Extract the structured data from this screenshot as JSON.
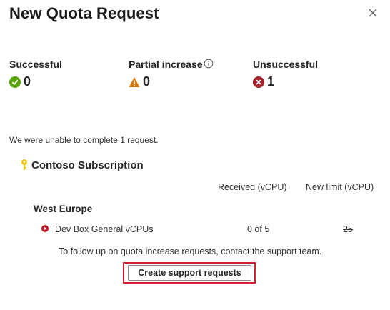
{
  "dialog": {
    "title": "New Quota Request"
  },
  "stats": {
    "successful": {
      "label": "Successful",
      "value": "0",
      "icon": "success-check-icon",
      "color": "#57a300"
    },
    "partial": {
      "label": "Partial increase",
      "value": "0",
      "icon": "warning-triangle-icon",
      "color": "#db7500"
    },
    "unsuccessful": {
      "label": "Unsuccessful",
      "value": "1",
      "icon": "error-x-icon",
      "color": "#a4262c"
    }
  },
  "message": "We were unable to complete 1 request.",
  "subscription": {
    "name": "Contoso Subscription",
    "icon": "key-icon",
    "icon_color": "#f2c811"
  },
  "table": {
    "columns": [
      "Received (vCPU)",
      "New limit (vCPU)"
    ],
    "region": "West Europe",
    "rows": [
      {
        "name": "Dev Box General vCPUs",
        "received": "0 of 5",
        "new_limit": "25",
        "status": "error"
      }
    ]
  },
  "followup": "To follow up on quota increase requests, contact the support team.",
  "actions": {
    "create_support": "Create support requests"
  },
  "colors": {
    "highlight": "#d1202f"
  }
}
